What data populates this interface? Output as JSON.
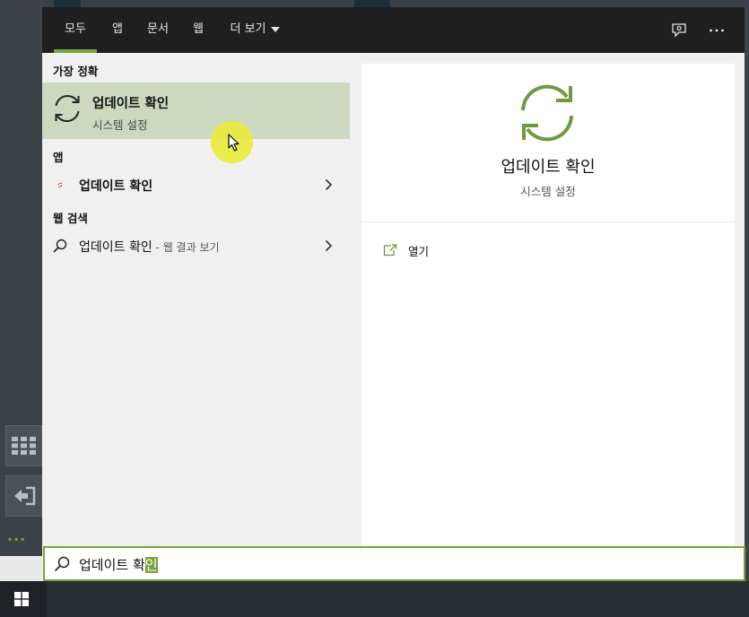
{
  "tabs": [
    {
      "label": "모두",
      "active": true
    },
    {
      "label": "앱"
    },
    {
      "label": "문서"
    },
    {
      "label": "웹"
    },
    {
      "label": "더 보기"
    }
  ],
  "toolbar_icons": [
    "feedback-icon",
    "more-options-icon"
  ],
  "results": {
    "best_match_header": "가장 정확",
    "best_match": {
      "title": "업데이트 확인",
      "subtitle": "시스템 설정"
    },
    "apps_header": "앱",
    "app_item": {
      "title": "업데이트 확인"
    },
    "web_header": "웹 검색",
    "web_item": {
      "title": "업데이트 확인",
      "suffix": " - 웹 결과 보기"
    }
  },
  "preview": {
    "title": "업데이트 확인",
    "subtitle": "시스템 설정",
    "open_label": "열기"
  },
  "search": {
    "typed": "업데이트 확",
    "selected": "인"
  },
  "colors": {
    "accent": "#7aa43b",
    "best_match_bg": "#ccd9bf",
    "tabbar_bg": "#1f1f1f"
  }
}
